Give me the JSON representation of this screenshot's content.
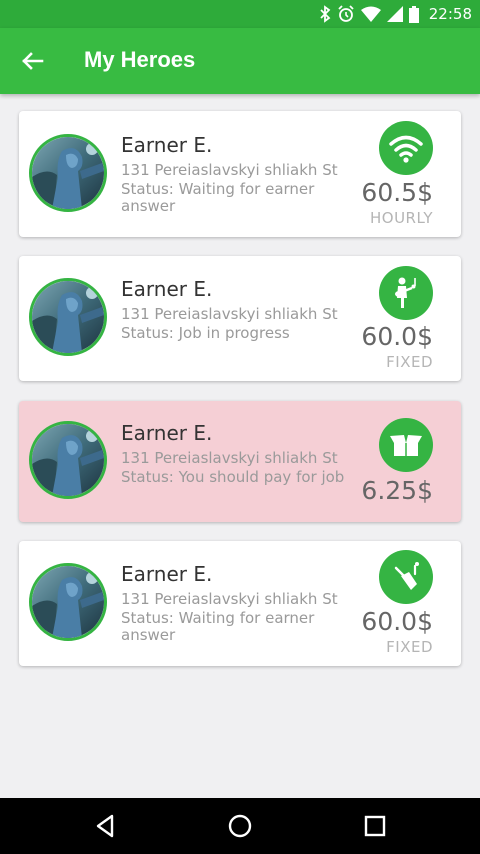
{
  "status_bar": {
    "time": "22:58",
    "icons": [
      "bluetooth-icon",
      "alarm-icon",
      "wifi-icon",
      "signal-icon",
      "battery-icon"
    ]
  },
  "app_bar": {
    "title": "My Heroes",
    "back_icon": "arrow-back-icon"
  },
  "cards": [
    {
      "name": "Earner E.",
      "address": "131 Pereiaslavskyi shliakh St",
      "status": "Status: Waiting for earner answer",
      "price": "60.5$",
      "type": "HOURLY",
      "icon": "wifi-icon",
      "highlighted": false
    },
    {
      "name": "Earner E.",
      "address": "131 Pereiaslavskyi shliakh St",
      "status": "Status: Job in progress",
      "price": "60.0$",
      "type": "FIXED",
      "icon": "musician-icon",
      "highlighted": false
    },
    {
      "name": "Earner E.",
      "address": "131 Pereiaslavskyi shliakh St",
      "status": "Status: You should pay for job",
      "price": "6.25$",
      "type": "",
      "icon": "open-box-icon",
      "highlighted": true
    },
    {
      "name": "Earner E.",
      "address": "131 Pereiaslavskyi shliakh St",
      "status": "Status: Waiting for earner answer",
      "price": "60.0$",
      "type": "FIXED",
      "icon": "cleaning-icon",
      "highlighted": false
    }
  ],
  "colors": {
    "status_bar": "#2eab3a",
    "app_bar": "#38bb42",
    "accent": "#35b443",
    "highlight_card": "#f5cfd5"
  },
  "nav_bar": {
    "icons": [
      "back-triangle-icon",
      "home-circle-icon",
      "recents-square-icon"
    ]
  }
}
